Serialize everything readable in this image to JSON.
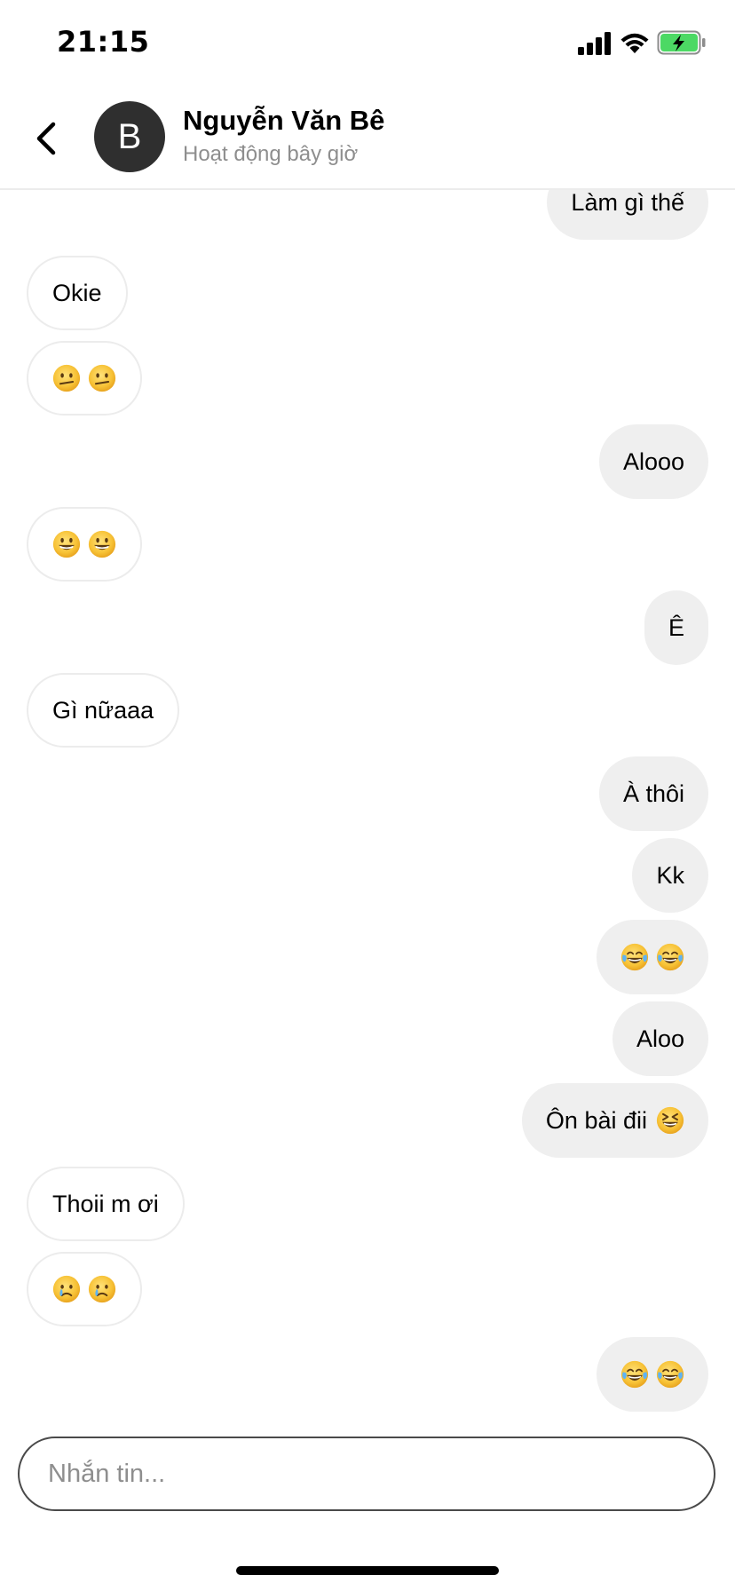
{
  "status_bar": {
    "time": "21:15",
    "icons": [
      "signal-icon",
      "wifi-icon",
      "battery-charging-icon"
    ]
  },
  "header": {
    "avatar_initial": "B",
    "contact_name": "Nguyễn Văn Bê",
    "contact_status": "Hoạt động bây giờ",
    "back_icon": "chevron-left-icon"
  },
  "messages": [
    {
      "side": "sent",
      "text": "Làm gì thế"
    },
    {
      "side": "received",
      "text": "Okie"
    },
    {
      "side": "received",
      "emoji": "confused-face",
      "count": 2
    },
    {
      "side": "sent",
      "text": "Alooo"
    },
    {
      "side": "received",
      "emoji": "grinning-face",
      "count": 2
    },
    {
      "side": "sent",
      "text": "Ê"
    },
    {
      "side": "received",
      "text": "Gì nữaaa"
    },
    {
      "side": "sent",
      "text": "À thôi"
    },
    {
      "side": "sent",
      "text": "Kk"
    },
    {
      "side": "sent",
      "emoji": "tears-of-joy-face",
      "count": 2
    },
    {
      "side": "sent",
      "text": "Aloo"
    },
    {
      "side": "sent",
      "text": "Ôn bài đii",
      "emoji": "laughing-squint-face",
      "count": 1
    },
    {
      "side": "received",
      "text": "Thoii m ơi"
    },
    {
      "side": "received",
      "emoji": "crying-face",
      "count": 2
    },
    {
      "side": "sent",
      "emoji": "tears-of-joy-face",
      "count": 2
    }
  ],
  "composer": {
    "placeholder": "Nhắn tin..."
  },
  "colors": {
    "sent_bubble": "#efefef",
    "received_border": "#ececec",
    "avatar_bg": "#2f2f2f",
    "status_text": "#8e8e8e",
    "emoji_yellow": "#f7c236",
    "battery_green": "#4cd964"
  }
}
